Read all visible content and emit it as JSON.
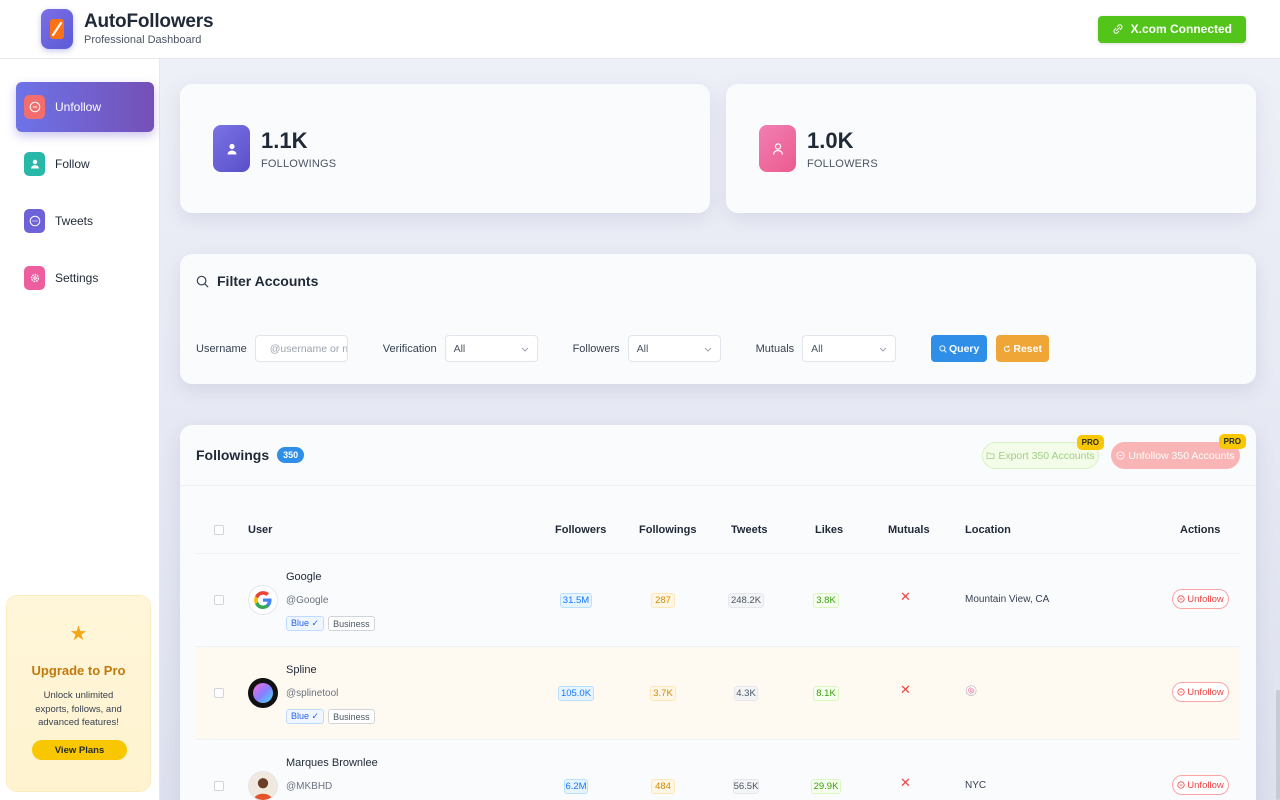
{
  "app": {
    "title": "AutoFollowers",
    "subtitle": "Professional Dashboard",
    "status": "X.com Connected",
    "accent": "#6d73e8"
  },
  "sidebar": {
    "items": [
      {
        "label": "Unfollow",
        "icon": "minus-circle-icon",
        "active": true
      },
      {
        "label": "Follow",
        "icon": "user-icon",
        "active": false
      },
      {
        "label": "Tweets",
        "icon": "chat-icon",
        "active": false
      },
      {
        "label": "Settings",
        "icon": "gear-icon",
        "active": false
      }
    ],
    "promo": {
      "title": "Upgrade to Pro",
      "text": "Unlock unlimited exports, follows, and advanced features!",
      "button": "View Plans"
    }
  },
  "stats": [
    {
      "value": "1.1K",
      "label": "FOLLOWINGS",
      "color": "#6d5ed6"
    },
    {
      "value": "1.0K",
      "label": "FOLLOWERS",
      "color": "#f0609a"
    }
  ],
  "filter": {
    "title": "Filter Accounts",
    "username_label": "Username",
    "username_placeholder": "@username or n",
    "verification_label": "Verification",
    "verification_value": "All",
    "followers_label": "Followers",
    "followers_value": "All",
    "mutuals_label": "Mutuals",
    "mutuals_value": "All",
    "query_button": "Query",
    "reset_button": "Reset"
  },
  "table": {
    "title": "Followings",
    "count": "350",
    "export_button": "Export 350 Accounts",
    "unfollow_all_button": "Unfollow 350 Accounts",
    "pro_tag": "PRO",
    "columns": [
      "User",
      "Followers",
      "Followings",
      "Tweets",
      "Likes",
      "Mutuals",
      "Location",
      "Actions"
    ],
    "rows": [
      {
        "name": "Google",
        "handle": "@Google",
        "tags": [
          "Blue ✓",
          "Business"
        ],
        "followers": "31.5M",
        "followings": "287",
        "tweets": "248.2K",
        "likes": "3.8K",
        "mutual": "✕",
        "location": "Mountain View, CA",
        "action": "Unfollow"
      },
      {
        "name": "Spline",
        "handle": "@splinetool",
        "tags": [
          "Blue ✓",
          "Business"
        ],
        "followers": "105.0K",
        "followings": "3.7K",
        "tweets": "4.3K",
        "likes": "8.1K",
        "mutual": "✕",
        "location": "🍥",
        "action": "Unfollow"
      },
      {
        "name": "Marques Brownlee",
        "handle": "@MKBHD",
        "tags": [],
        "followers": "6.2M",
        "followings": "484",
        "tweets": "56.5K",
        "likes": "29.9K",
        "mutual": "✕",
        "location": "NYC",
        "action": "Unfollow"
      }
    ]
  }
}
